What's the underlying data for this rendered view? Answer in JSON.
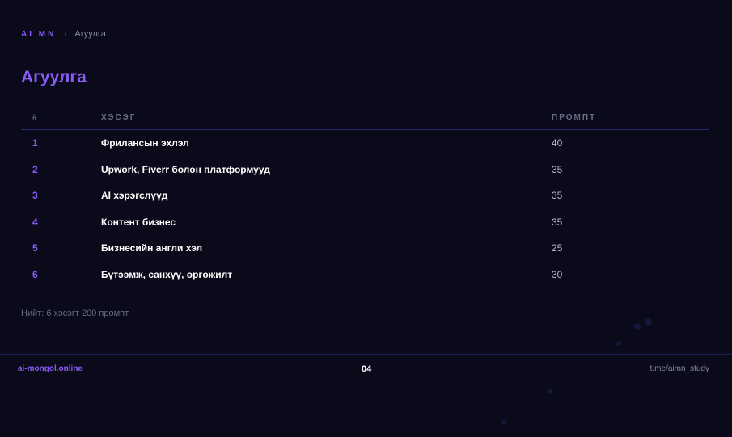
{
  "header": {
    "brand": "AI MN",
    "separator": "/",
    "current": "Агуулга"
  },
  "page_title": "Агуулга",
  "table": {
    "columns": [
      "#",
      "ХЭСЭГ",
      "ПРОМПТ"
    ],
    "rows": [
      {
        "num": "1",
        "section": "Фрилансын эхлэл",
        "prompts": "40"
      },
      {
        "num": "2",
        "section": "Upwork, Fiverr болон платформууд",
        "prompts": "35"
      },
      {
        "num": "3",
        "section": "AI хэрэгслүүд",
        "prompts": "35"
      },
      {
        "num": "4",
        "section": "Контент бизнес",
        "prompts": "35"
      },
      {
        "num": "5",
        "section": "Бизнесийн англи хэл",
        "prompts": "25"
      },
      {
        "num": "6",
        "section": "Бүтээмж, санхүү, өргөжилт",
        "prompts": "30"
      }
    ]
  },
  "summary": "Нийт: 6 хэсэгт 200 промпт.",
  "footer": {
    "site": "ai-mongol.online",
    "page_number": "04",
    "telegram": "t.me/aimn_study"
  },
  "colors": {
    "background": "#0a0a1a",
    "accent": "#8b5cf6",
    "rule": "#2a2a6a"
  }
}
